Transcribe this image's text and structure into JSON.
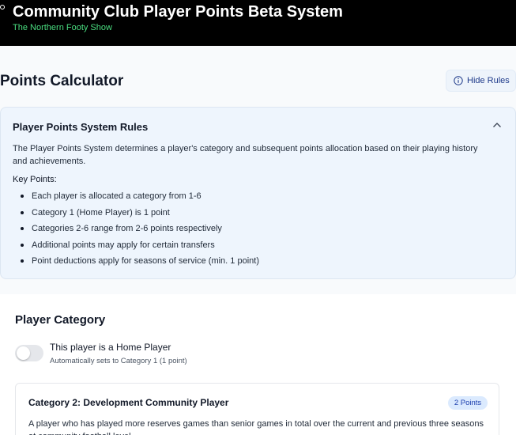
{
  "header": {
    "title": "Community Club Player Points Beta System",
    "subtitle": "The Northern Footy Show"
  },
  "page": {
    "title": "Points Calculator",
    "hide_rules_label": "Hide Rules"
  },
  "rules": {
    "title": "Player Points System Rules",
    "description": "The Player Points System determines a player's category and subsequent points allocation based on their playing history and achievements.",
    "key_points_label": "Key Points:",
    "items": [
      "Each player is allocated a category from 1-6",
      "Category 1 (Home Player) is 1 point",
      "Categories 2-6 range from 2-6 points respectively",
      "Additional points may apply for certain transfers",
      "Point deductions apply for seasons of service (min. 1 point)"
    ]
  },
  "player_category": {
    "title": "Player Category",
    "home_player_toggle": {
      "label": "This player is a Home Player",
      "hint": "Automatically sets to Category 1 (1 point)",
      "checked": false
    },
    "card": {
      "title": "Category 2: Development Community Player",
      "badge": "2 Points",
      "description": "A player who has played more reserves games than senior games in total over the current and previous three seasons at community football level."
    }
  },
  "colors": {
    "header_bg": "#000000",
    "subtitle": "#4ade80",
    "accent": "#1e3a8a",
    "panel_bg": "#eef5fd",
    "badge_bg": "#dbeafe"
  },
  "icons": {
    "hide_rules": "info-circle-icon",
    "collapse": "chevron-up-icon"
  }
}
